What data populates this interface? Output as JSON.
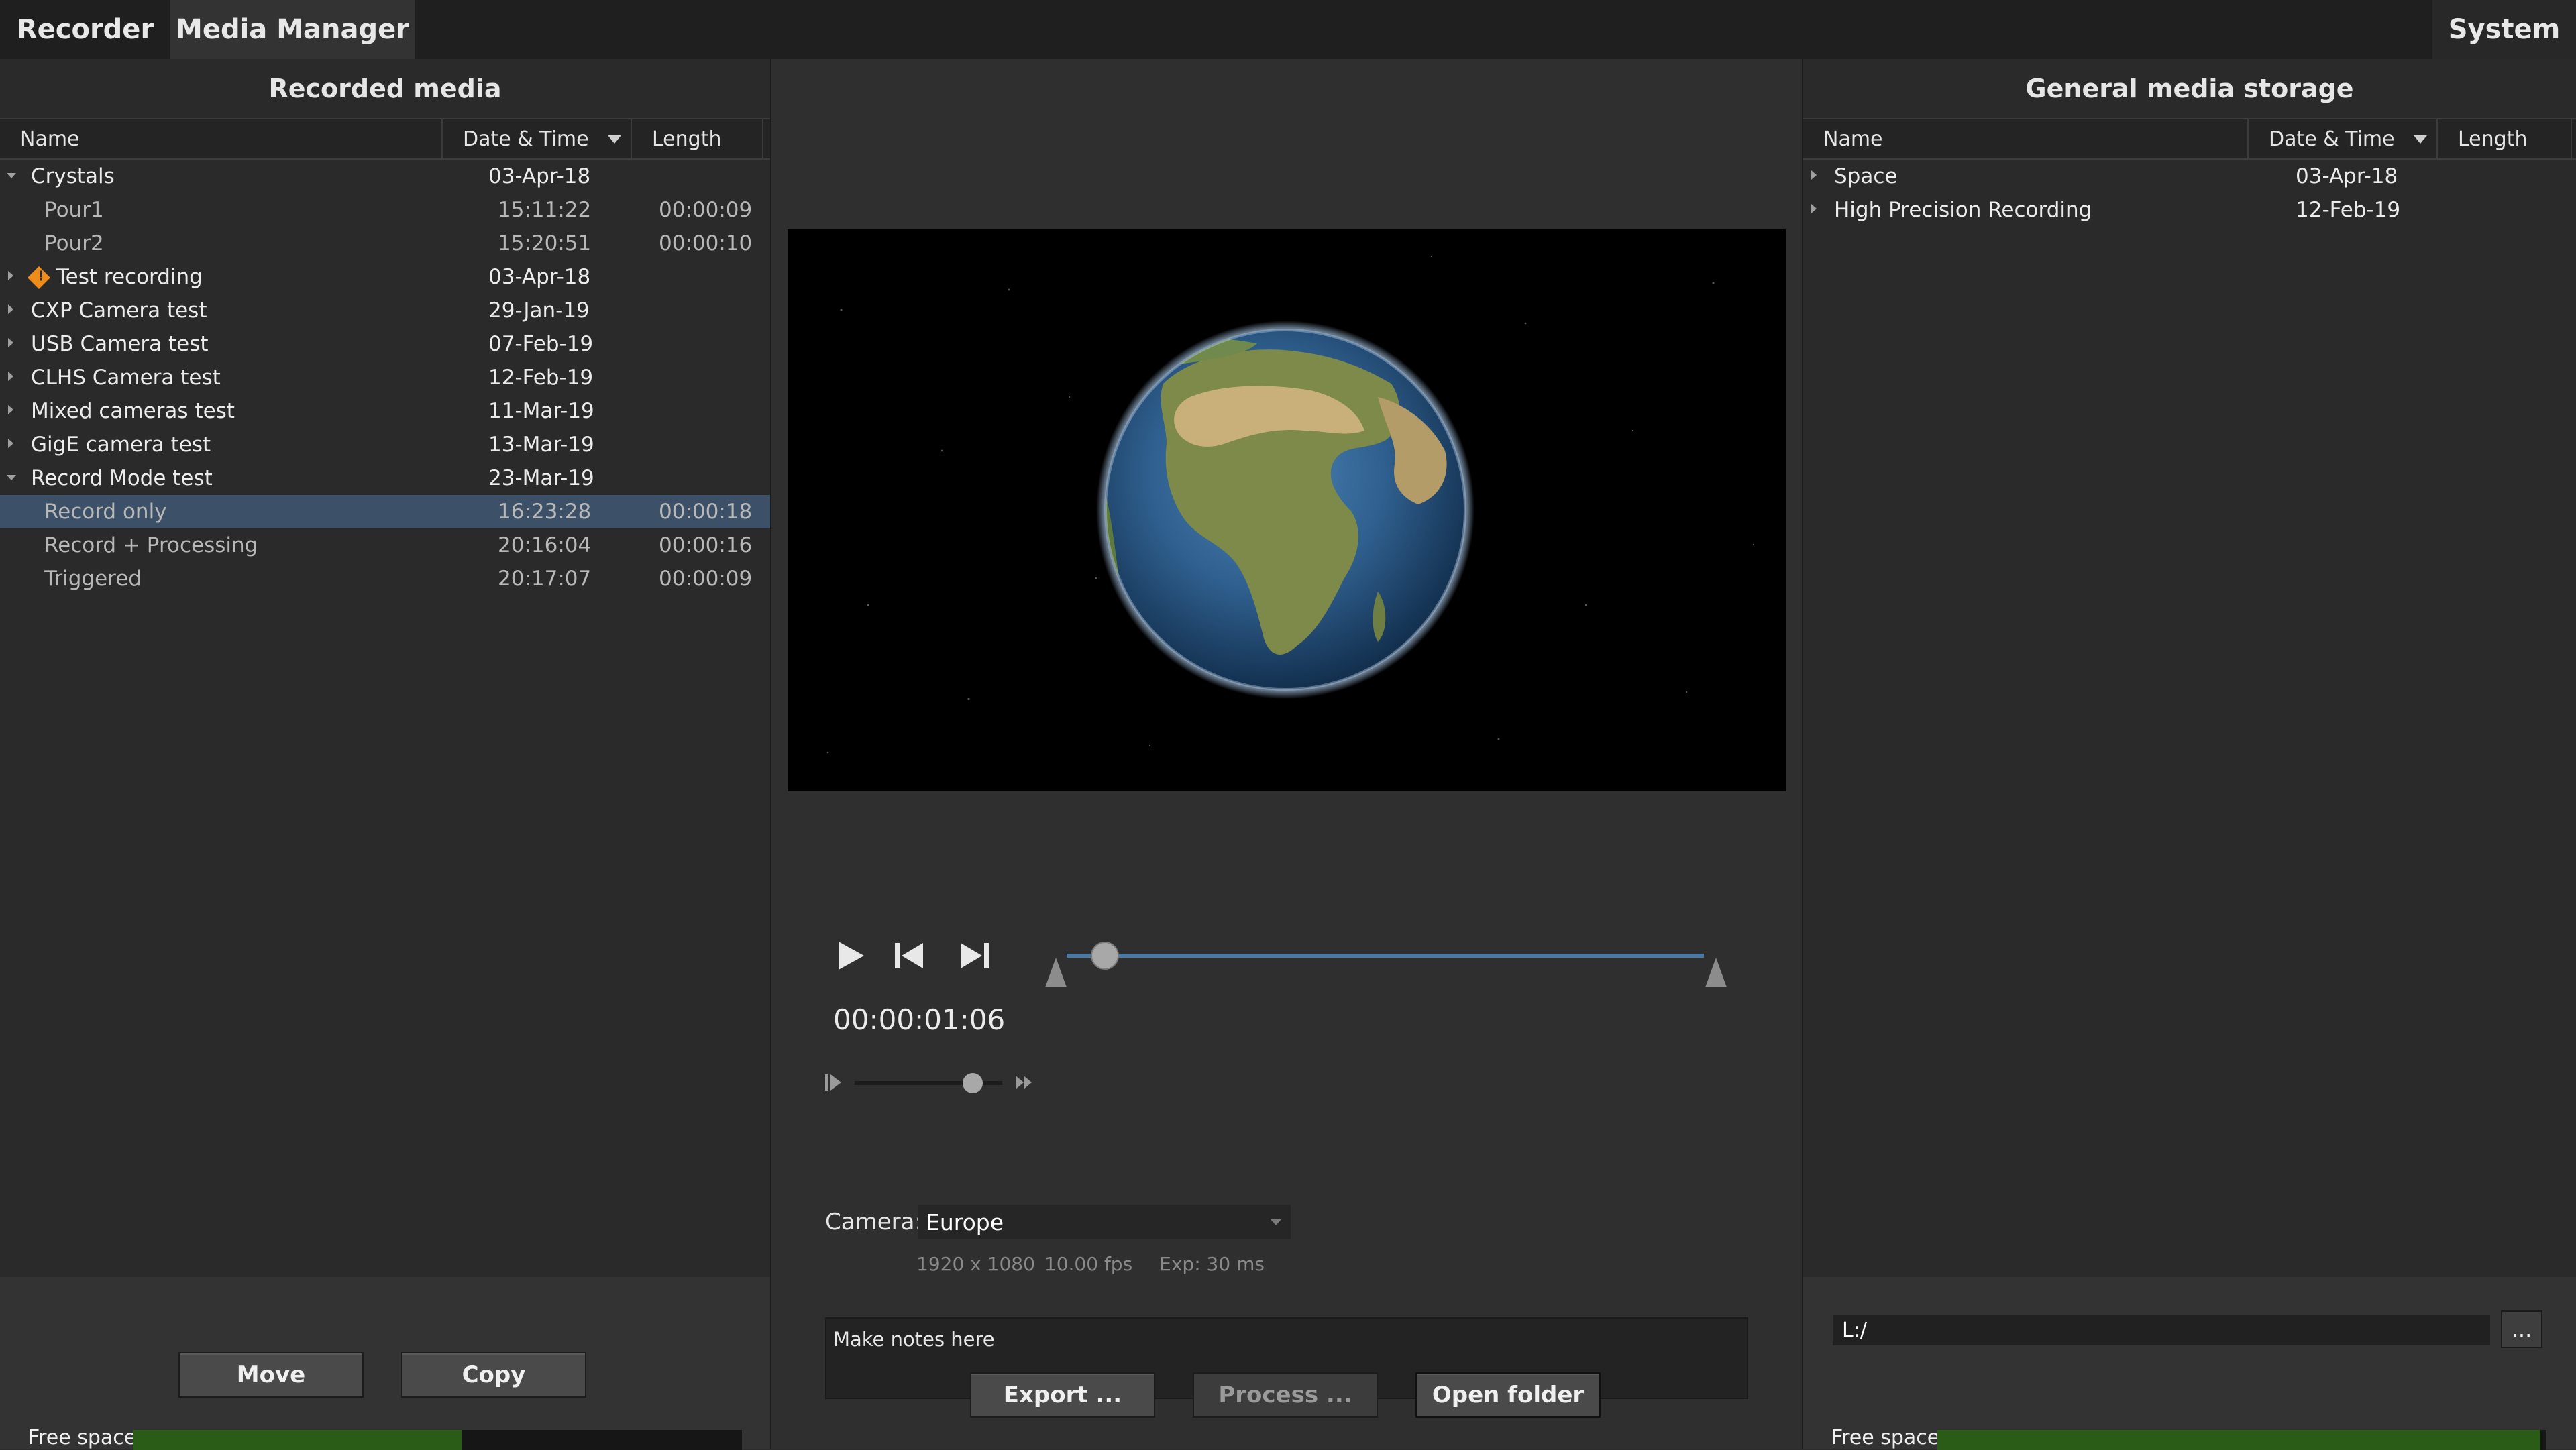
{
  "tabs": {
    "recorder": "Recorder",
    "media_manager": "Media Manager",
    "system": "System"
  },
  "left": {
    "title": "Recorded media",
    "columns": [
      "Name",
      "Date & Time",
      "Length"
    ],
    "rows": [
      {
        "name": "Crystals",
        "date": "03-Apr-18",
        "length": "",
        "level": 0,
        "expander": "open"
      },
      {
        "name": "Pour1",
        "date": "15:11:22",
        "length": "00:00:09",
        "level": 1
      },
      {
        "name": "Pour2",
        "date": "15:20:51",
        "length": "00:00:10",
        "level": 1
      },
      {
        "name": "Test recording",
        "date": "03-Apr-18",
        "length": "",
        "level": 0,
        "expander": "closed",
        "warning": true
      },
      {
        "name": "CXP Camera test",
        "date": "29-Jan-19",
        "length": "",
        "level": 0,
        "expander": "closed"
      },
      {
        "name": "USB Camera test",
        "date": "07-Feb-19",
        "length": "",
        "level": 0,
        "expander": "closed"
      },
      {
        "name": "CLHS Camera test",
        "date": "12-Feb-19",
        "length": "",
        "level": 0,
        "expander": "closed"
      },
      {
        "name": "Mixed cameras test",
        "date": "11-Mar-19",
        "length": "",
        "level": 0,
        "expander": "closed"
      },
      {
        "name": "GigE camera test",
        "date": "13-Mar-19",
        "length": "",
        "level": 0,
        "expander": "closed"
      },
      {
        "name": "Record Mode test",
        "date": "23-Mar-19",
        "length": "",
        "level": 0,
        "expander": "open"
      },
      {
        "name": "Record only",
        "date": "16:23:28",
        "length": "00:00:18",
        "level": 1,
        "selected": true
      },
      {
        "name": "Record + Processing",
        "date": "20:16:04",
        "length": "00:00:16",
        "level": 1
      },
      {
        "name": "Triggered",
        "date": "20:17:07",
        "length": "00:00:09",
        "level": 1
      }
    ],
    "buttons": {
      "move": "Move",
      "copy": "Copy"
    },
    "free_space_label": "Free space:",
    "free_space_fraction": 0.54
  },
  "center": {
    "timecode": "00:00:01:06",
    "timeline_position": 0.06,
    "speed_position": 0.8,
    "camera_label": "Camera:",
    "camera_value": "Europe",
    "camera_info": {
      "resolution": "1920 x 1080",
      "fps": "10.00 fps",
      "exposure": "Exp: 30 ms"
    },
    "notes_placeholder": "Make notes here",
    "buttons": {
      "export": "Export ...",
      "process": "Process ...",
      "open_folder": "Open folder"
    }
  },
  "right": {
    "title": "General media storage",
    "columns": [
      "Name",
      "Date & Time",
      "Length"
    ],
    "rows": [
      {
        "name": "Space",
        "date": "03-Apr-18",
        "length": "",
        "level": 0,
        "expander": "closed"
      },
      {
        "name": "High Precision Recording",
        "date": "12-Feb-19",
        "length": "",
        "level": 0,
        "expander": "closed"
      }
    ],
    "path": "L:/",
    "browse_label": "...",
    "free_space_label": "Free space:",
    "free_space_fraction": 0.99
  },
  "colors": {
    "selection": "#3c5168",
    "free_space": "#2b5c17",
    "warning": "#f08c1a",
    "timeline": "#4a79a4"
  }
}
